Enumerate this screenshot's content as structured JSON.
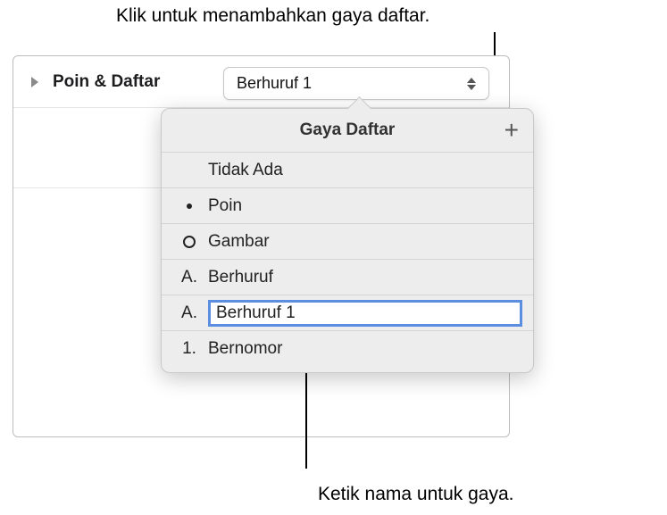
{
  "callouts": {
    "top": "Klik untuk menambahkan gaya daftar.",
    "bottom": "Ketik nama untuk gaya."
  },
  "section": {
    "label": "Poin & Daftar"
  },
  "dropdown": {
    "value": "Berhuruf 1"
  },
  "popover": {
    "title": "Gaya Daftar",
    "add_icon": "+",
    "items": [
      {
        "preview_type": "none",
        "preview_text": "",
        "label": "Tidak Ada"
      },
      {
        "preview_type": "bullet",
        "preview_text": "",
        "label": "Poin"
      },
      {
        "preview_type": "circle",
        "preview_text": "",
        "label": "Gambar"
      },
      {
        "preview_type": "text",
        "preview_text": "A.",
        "label": "Berhuruf"
      },
      {
        "preview_type": "text",
        "preview_text": "A.",
        "label": "Berhuruf 1",
        "editing": true
      },
      {
        "preview_type": "text",
        "preview_text": "1.",
        "label": "Bernomor"
      }
    ]
  }
}
